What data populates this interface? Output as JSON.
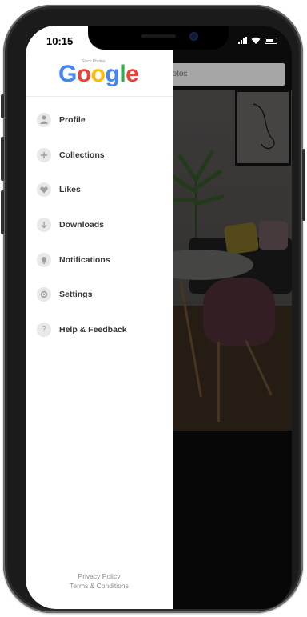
{
  "status_bar": {
    "time": "10:15"
  },
  "search": {
    "placeholder": "hotos"
  },
  "drawer": {
    "logo_text": "Google",
    "logo_subtitle": "Stock Photos",
    "items": [
      {
        "label": "Profile",
        "icon": "person-icon"
      },
      {
        "label": "Collections",
        "icon": "plus-icon"
      },
      {
        "label": "Likes",
        "icon": "heart-icon"
      },
      {
        "label": "Downloads",
        "icon": "download-icon"
      },
      {
        "label": "Notifications",
        "icon": "bell-icon"
      },
      {
        "label": "Settings",
        "icon": "gear-icon"
      },
      {
        "label": "Help & Feedback",
        "icon": "question-icon"
      }
    ],
    "footer": {
      "privacy": "Privacy Policy",
      "terms": "Terms & Conditions"
    }
  },
  "colors": {
    "google_blue": "#4285F4",
    "google_red": "#EA4335",
    "google_yellow": "#FBBC05",
    "google_green": "#34A853"
  }
}
